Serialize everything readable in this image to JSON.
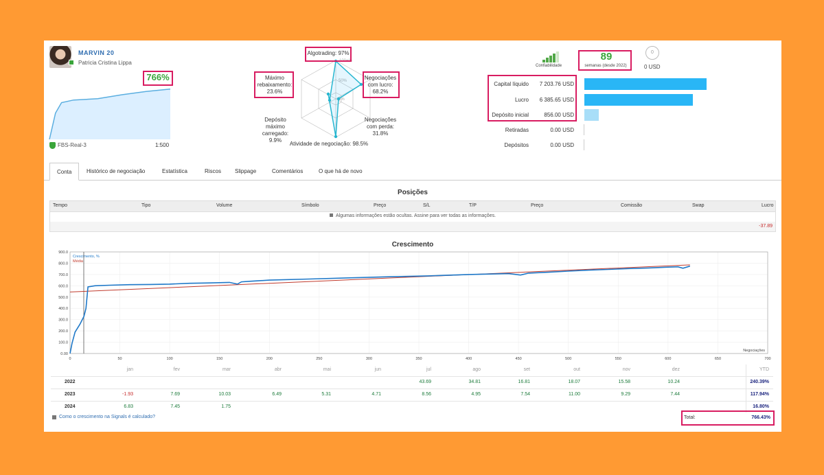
{
  "profile": {
    "signal_name": "MARVIN 20",
    "author": "Patricia Cristina Lippa",
    "growth_badge": "766%",
    "account": "FBS-Real-3",
    "leverage": "1:500",
    "mini_chart": {
      "type": "area",
      "x": [
        0,
        5,
        10,
        20,
        40,
        60,
        80,
        100
      ],
      "values": [
        0,
        400,
        560,
        600,
        620,
        680,
        730,
        766
      ]
    }
  },
  "radar": {
    "algotrading": "Algotrading: 97%",
    "max_drawdown": "Máximo rebaixamento: 23.6%",
    "profit_trades": "Negociações com lucro: 68.2%",
    "loss_trades": "Negociações com perda: 31.8%",
    "max_deposit_load": "Depósito máximo carregado: 9.9%",
    "trading_activity": "Atividade de negociação: 98.5%",
    "ring_labels": [
      "100+%",
      "50%",
      "0%"
    ]
  },
  "stats": {
    "reliability_label": "Confiabilidade",
    "weeks_value": "89",
    "weeks_label": "semanas (desde 2022)",
    "subscribers_icon": "0",
    "subscribers_value": "0 USD",
    "rows": [
      {
        "label": "Capital líquido",
        "value": "7 203.76 USD",
        "amount": 7203.76
      },
      {
        "label": "Lucro",
        "value": "6 385.65 USD",
        "amount": 6385.65
      },
      {
        "label": "Depósito inicial",
        "value": "856.00 USD",
        "amount": 856.0
      },
      {
        "label": "Retiradas",
        "value": "0.00 USD",
        "amount": 0
      },
      {
        "label": "Depósitos",
        "value": "0.00 USD",
        "amount": 0
      }
    ]
  },
  "tabs": [
    "Conta",
    "Histórico de negociação",
    "Estatística",
    "Riscos",
    "Slippage",
    "Comentários",
    "O que há de novo"
  ],
  "positions": {
    "title": "Posições",
    "headers": [
      "Tempo",
      "Tipo",
      "Volume",
      "Símbolo",
      "Preço",
      "S/L",
      "T/P",
      "Preço",
      "Comissão",
      "Swap",
      "Lucro"
    ],
    "note": "Algumas informações estão ocultas. Assine para ver todas as informações.",
    "total": "-37.89"
  },
  "growth": {
    "title": "Crescimento",
    "legend_growth": "Crescimento, %",
    "legend_avg": "Média",
    "xlabel": "Negociações"
  },
  "chart_data": {
    "type": "line",
    "xlim": [
      0,
      700
    ],
    "ylim": [
      0,
      900
    ],
    "xticks": [
      0,
      50,
      100,
      150,
      200,
      250,
      300,
      350,
      400,
      450,
      500,
      550,
      600,
      650,
      700
    ],
    "yticks": [
      "0.00",
      "100.0",
      "200.0",
      "300.0",
      "400.0",
      "500.0",
      "600.0",
      "700.0",
      "800.0",
      "900.0"
    ],
    "series": [
      {
        "name": "Crescimento, %",
        "color": "#1e78c8",
        "x": [
          0,
          2,
          5,
          10,
          14,
          16,
          18,
          25,
          40,
          60,
          80,
          100,
          120,
          140,
          160,
          168,
          172,
          180,
          200,
          240,
          280,
          320,
          360,
          400,
          440,
          452,
          460,
          480,
          500,
          520,
          540,
          560,
          580,
          600,
          610,
          615,
          622
        ],
        "values": [
          0,
          90,
          190,
          260,
          330,
          400,
          590,
          600,
          605,
          610,
          612,
          615,
          622,
          625,
          630,
          615,
          635,
          640,
          650,
          660,
          670,
          680,
          688,
          700,
          708,
          695,
          712,
          720,
          730,
          738,
          745,
          752,
          758,
          765,
          768,
          755,
          774
        ]
      },
      {
        "name": "Média",
        "color": "#c0392b",
        "x": [
          0,
          622
        ],
        "values": [
          545,
          785
        ]
      }
    ]
  },
  "monthly": {
    "months": [
      "jan",
      "fev",
      "mar",
      "abr",
      "mai",
      "jun",
      "jul",
      "ago",
      "set",
      "out",
      "nov",
      "dez",
      "YTD"
    ],
    "rows": [
      {
        "year": "2022",
        "values": [
          "",
          "",
          "",
          "",
          "",
          "",
          "43.69",
          "34.81",
          "16.81",
          "18.07",
          "15.58",
          "10.24",
          "240.39%"
        ]
      },
      {
        "year": "2023",
        "values": [
          "-1.93",
          "7.69",
          "10.03",
          "6.49",
          "5.31",
          "4.71",
          "8.56",
          "4.95",
          "7.54",
          "11.00",
          "9.29",
          "7.44",
          "117.94%"
        ]
      },
      {
        "year": "2024",
        "values": [
          "6.83",
          "7.45",
          "1.75",
          "",
          "",
          "",
          "",
          "",
          "",
          "",
          "",
          "",
          "16.80%"
        ]
      }
    ],
    "calc_link": "Como o crescimento na Signals é calculado?",
    "total_label": "Total:",
    "total_value": "766.43%"
  }
}
